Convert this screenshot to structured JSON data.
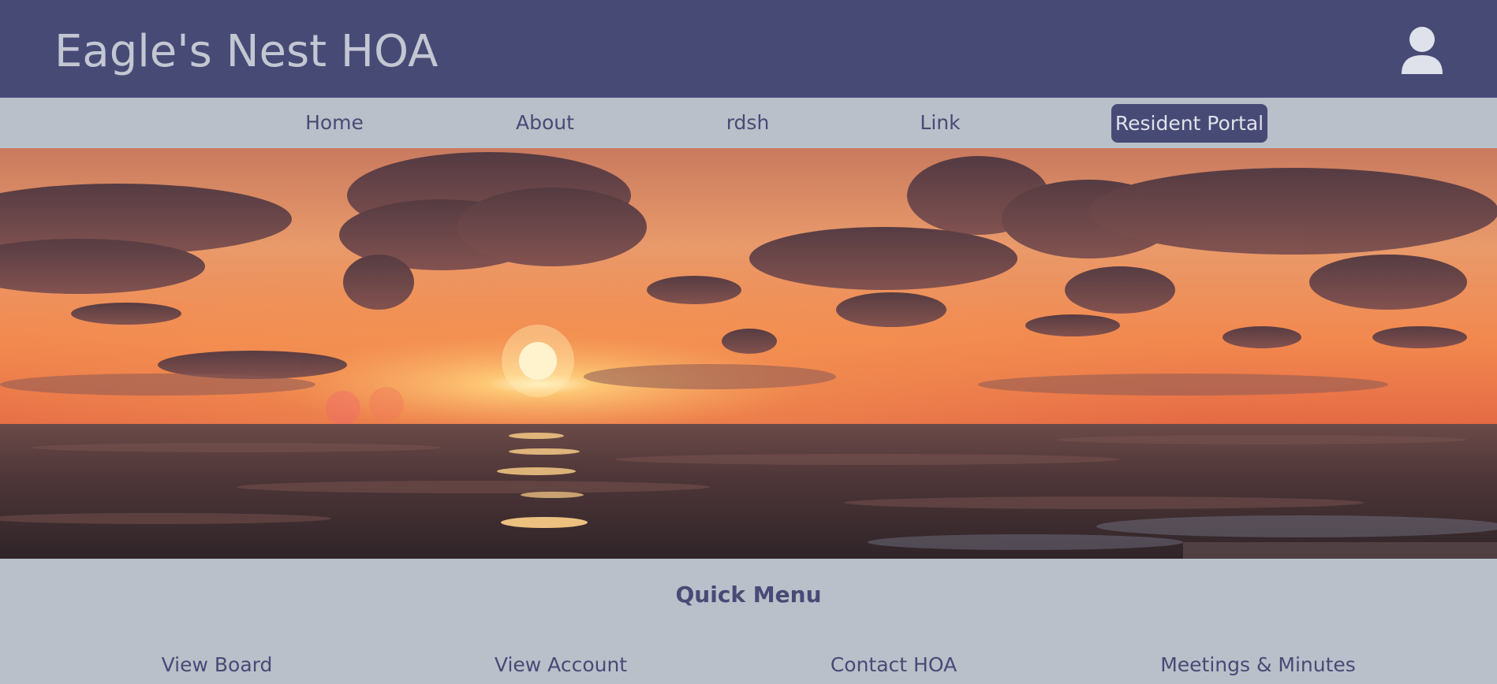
{
  "header": {
    "site_title": "Eagle's Nest HOA",
    "user_icon": "user-icon"
  },
  "nav": {
    "items": [
      {
        "label": "Home"
      },
      {
        "label": "About"
      },
      {
        "label": "rdsh"
      },
      {
        "label": "Link"
      }
    ],
    "portal_label": "Resident Portal"
  },
  "hero": {
    "image": "sunset over ocean"
  },
  "quick_menu": {
    "title": "Quick Menu",
    "links": [
      {
        "label": "View Board"
      },
      {
        "label": "View Account"
      },
      {
        "label": "Contact HOA"
      },
      {
        "label": "Meetings & Minutes"
      }
    ]
  },
  "colors": {
    "primary": "#484a76",
    "background": "#bac0c9",
    "title_text": "#c3c7d2"
  }
}
